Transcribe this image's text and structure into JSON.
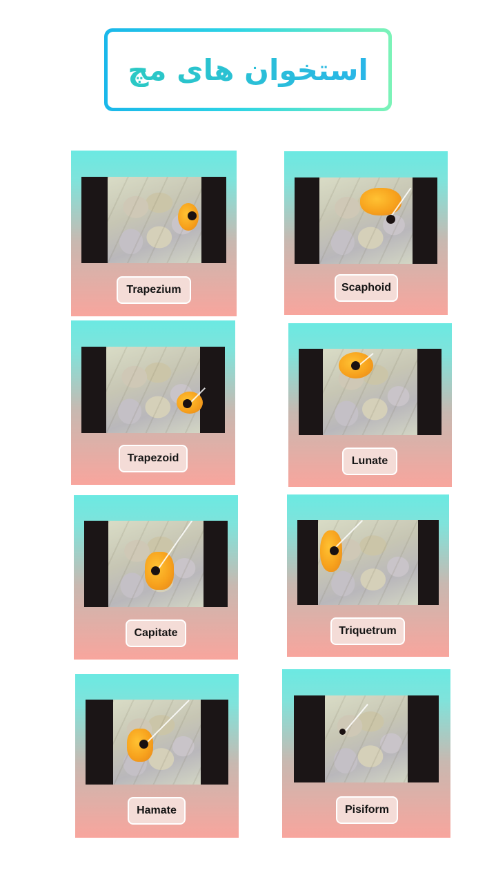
{
  "title": "استخوان های مچ",
  "colors": {
    "card_top": "#6be9e2",
    "card_bottom": "#f8a59d",
    "label_bg": "#f4dcd7",
    "title_gradient_start": "#1ab7ea",
    "title_gradient_end": "#7cf3b8",
    "bone_highlight": "#f7a21d"
  },
  "bones": [
    {
      "label": "Trapezium"
    },
    {
      "label": "Scaphoid"
    },
    {
      "label": "Trapezoid"
    },
    {
      "label": "Lunate"
    },
    {
      "label": "Capitate"
    },
    {
      "label": "Triquetrum"
    },
    {
      "label": "Hamate"
    },
    {
      "label": "Pisiform"
    }
  ]
}
